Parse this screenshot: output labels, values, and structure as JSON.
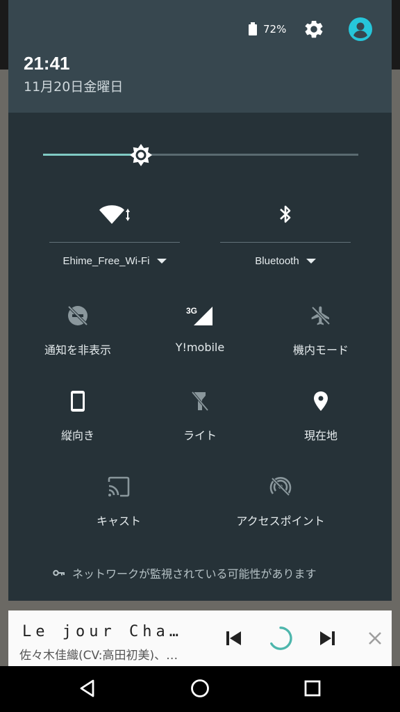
{
  "status": {
    "battery": "72%"
  },
  "header": {
    "time": "21:41",
    "date": "11月20日金曜日"
  },
  "brightness": {
    "level": 0.31
  },
  "wifi": {
    "ssid": "Ehime_Free_Wi-Fi",
    "icon": "wifi-icon"
  },
  "bluetooth": {
    "label": "Bluetooth",
    "icon": "bluetooth-icon"
  },
  "tiles": {
    "dnd": "通知を非表示",
    "mobile": "Y!mobile",
    "mobile_badge": "3G",
    "airplane": "機内モード",
    "rotation": "縦向き",
    "flashlight": "ライト",
    "location": "現在地",
    "cast": "キャスト",
    "hotspot": "アクセスポイント"
  },
  "footer": {
    "note": "ネットワークが監視されている可能性があります"
  },
  "media": {
    "title": "Le jour Cha…",
    "artist": "佐々木佳織(CV:高田初美)、…"
  },
  "colors": {
    "accent": "#80cbc4",
    "shade": "#263238",
    "header": "#37474f",
    "avatar": "#26c6da"
  }
}
